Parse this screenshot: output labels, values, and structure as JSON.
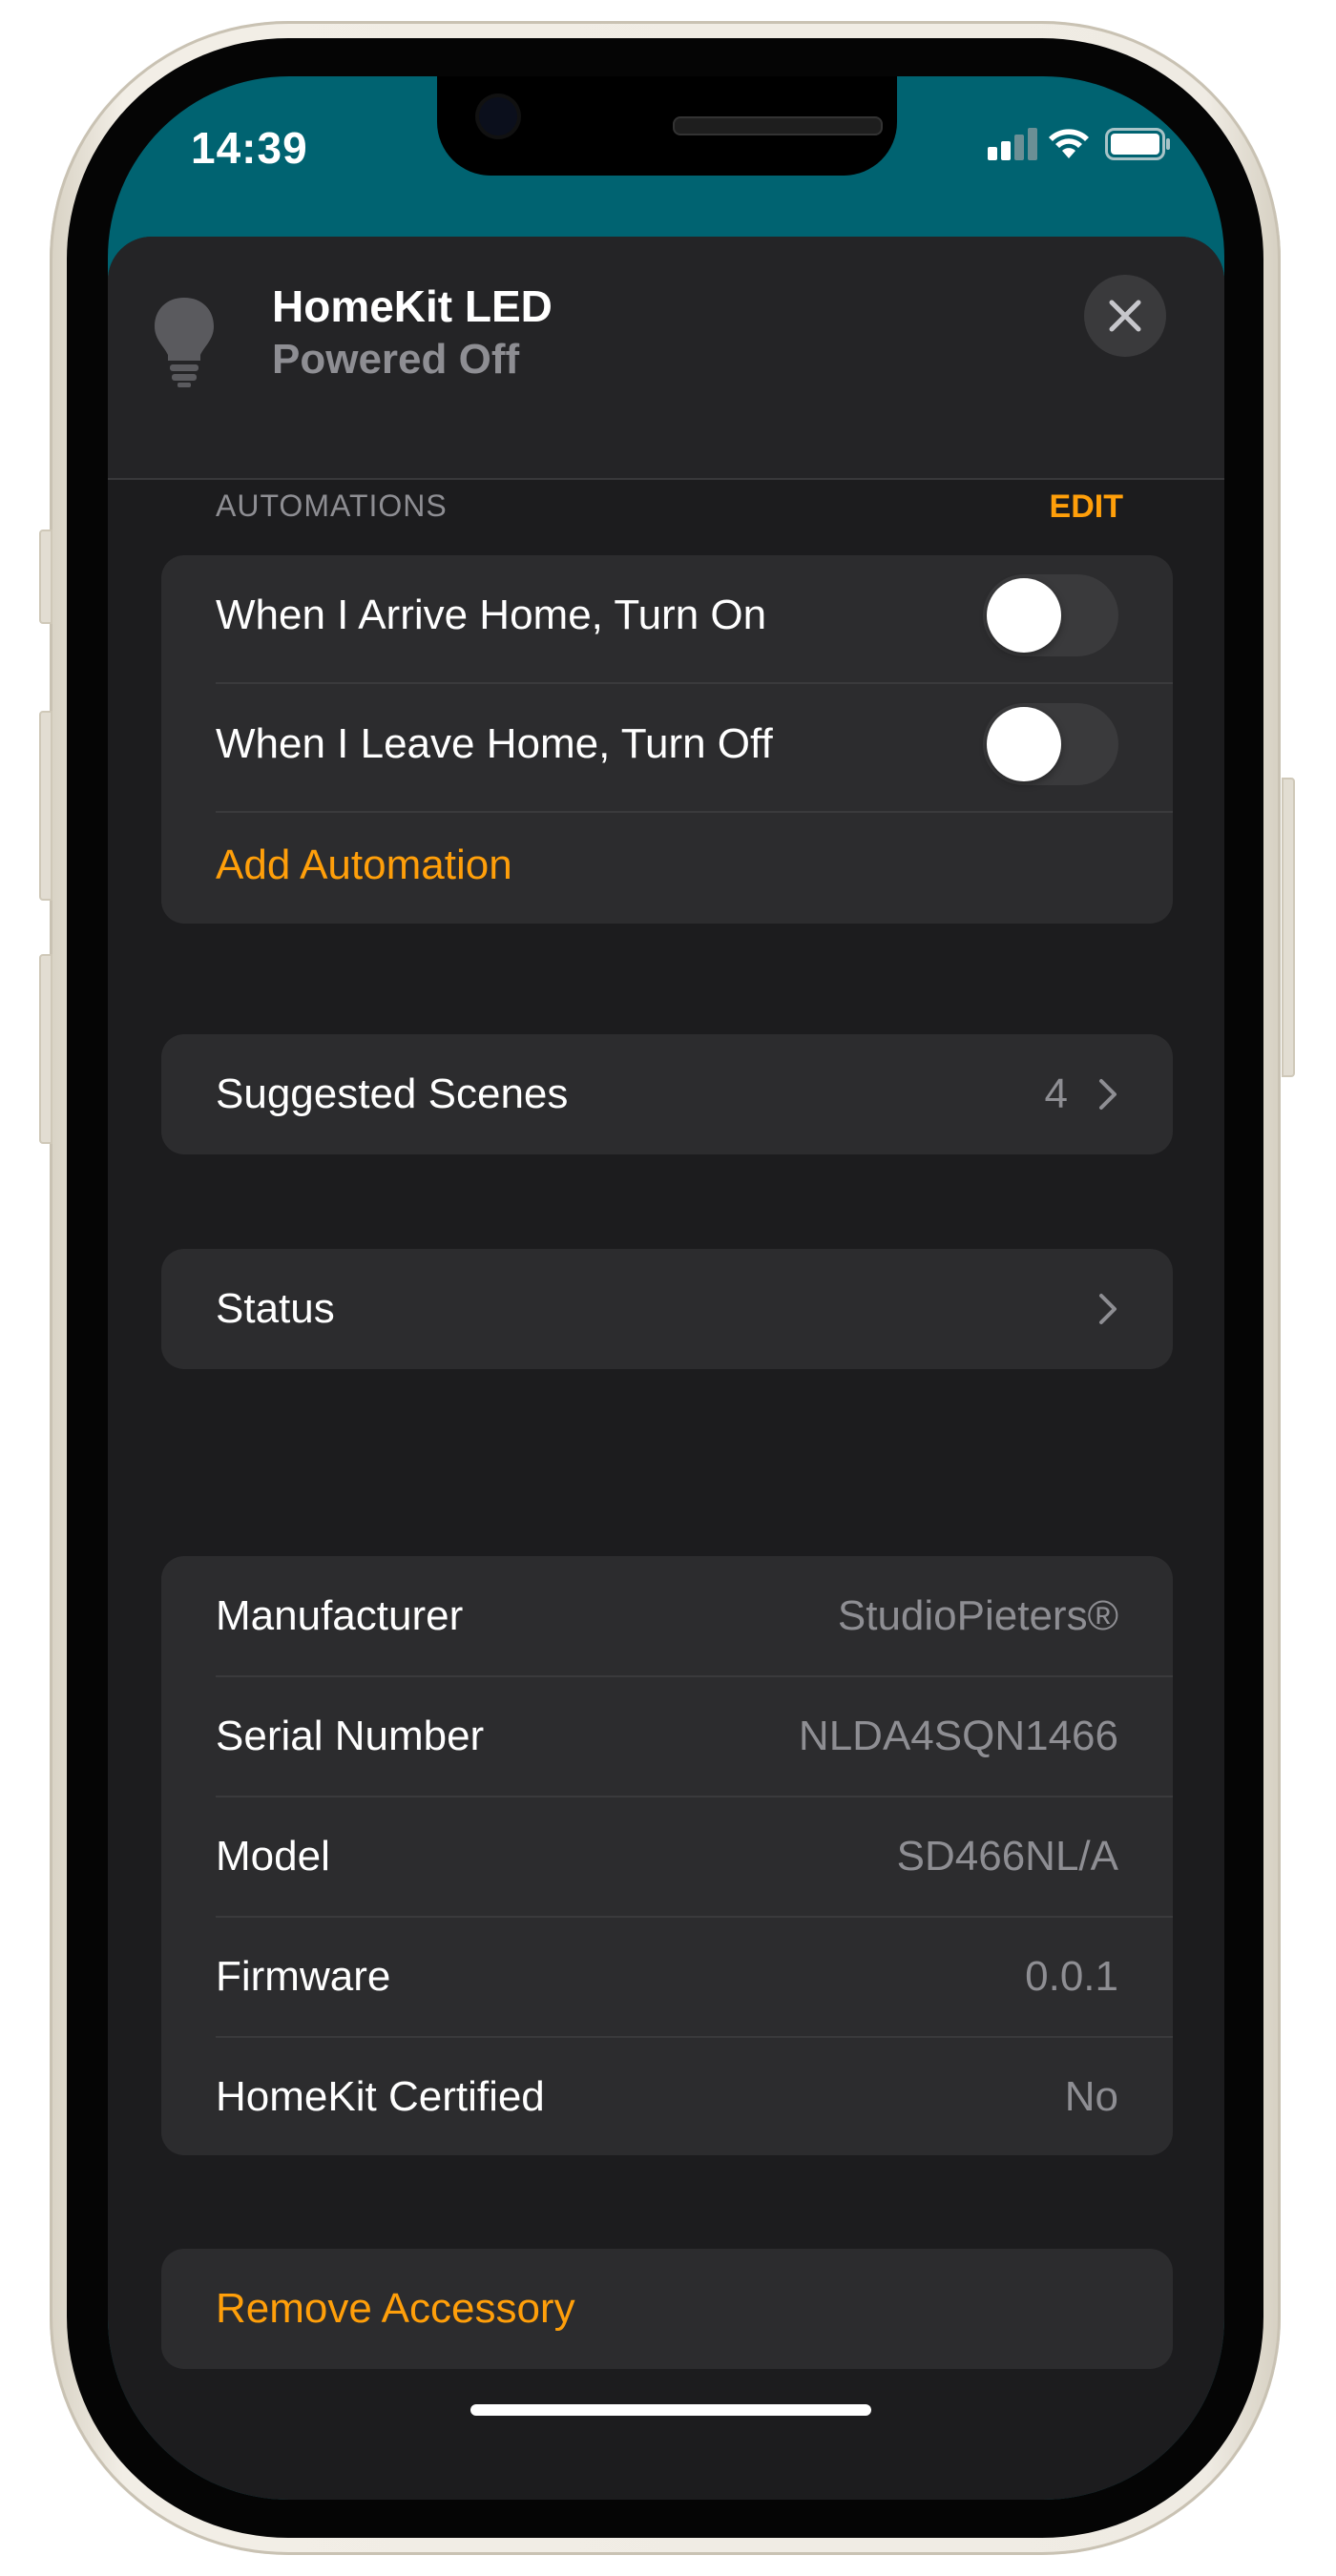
{
  "status_bar": {
    "time": "14:39"
  },
  "accessory": {
    "name": "HomeKit LED",
    "state": "Powered Off"
  },
  "automations": {
    "header": "AUTOMATIONS",
    "edit_label": "EDIT",
    "items": [
      {
        "label": "When I Arrive Home, Turn On",
        "enabled": false
      },
      {
        "label": "When I Leave Home, Turn Off",
        "enabled": false
      }
    ],
    "add_label": "Add Automation"
  },
  "suggested_scenes": {
    "label": "Suggested Scenes",
    "count": "4"
  },
  "status": {
    "label": "Status"
  },
  "info": {
    "rows": [
      {
        "label": "Manufacturer",
        "value": "StudioPieters®"
      },
      {
        "label": "Serial Number",
        "value": "NLDA4SQN1466"
      },
      {
        "label": "Model",
        "value": "SD466NL/A"
      },
      {
        "label": "Firmware",
        "value": "0.0.1"
      },
      {
        "label": "HomeKit Certified",
        "value": "No"
      }
    ]
  },
  "remove_label": "Remove Accessory",
  "colors": {
    "accent": "#ff9f0a",
    "header_teal": "#006371",
    "sheet_bg": "#1c1c1e",
    "card_bg": "#2c2c2e"
  }
}
